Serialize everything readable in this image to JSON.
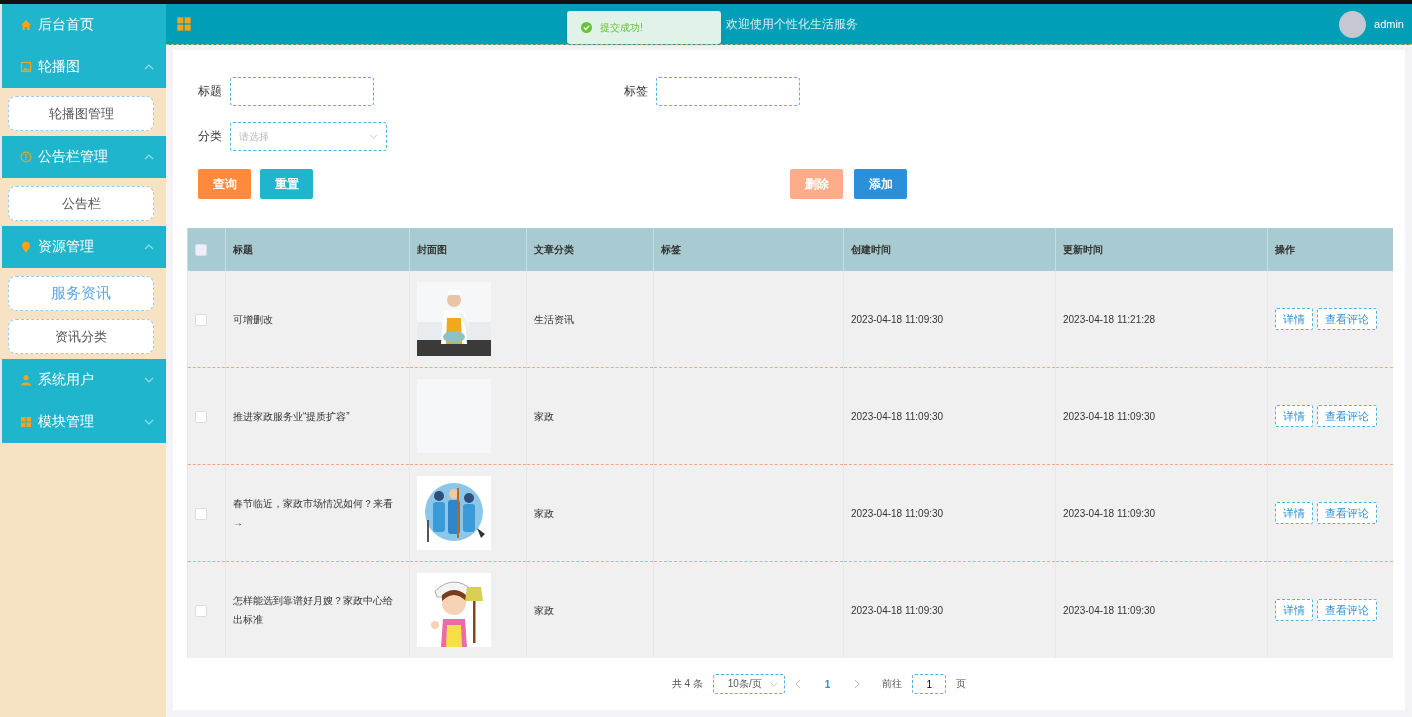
{
  "sidebar": {
    "items": [
      {
        "kind": "link",
        "label": "后台首页"
      },
      {
        "kind": "group",
        "label": "轮播图",
        "expanded": true,
        "children": [
          {
            "label": "轮播图管理",
            "selected": false
          }
        ]
      },
      {
        "kind": "group",
        "label": "公告栏管理",
        "expanded": true,
        "children": [
          {
            "label": "公告栏",
            "selected": false
          }
        ]
      },
      {
        "kind": "group",
        "label": "资源管理",
        "expanded": true,
        "children": [
          {
            "label": "服务资讯",
            "selected": true
          },
          {
            "label": "资讯分类",
            "selected": false
          }
        ]
      },
      {
        "kind": "group",
        "label": "系统用户",
        "expanded": false
      },
      {
        "kind": "group",
        "label": "模块管理",
        "expanded": false
      }
    ]
  },
  "header": {
    "title": "欢迎使用个性化生活服务",
    "user": "admin"
  },
  "toast": {
    "message": "提交成功!"
  },
  "filters": [
    {
      "kind": "input",
      "label": "标题"
    },
    {
      "kind": "input",
      "label": "标签"
    },
    {
      "kind": "select",
      "label": "分类",
      "placeholder": "请选择"
    }
  ],
  "actions_left": [
    {
      "label": "查询",
      "kind": "search",
      "disabled": false
    },
    {
      "label": "重置",
      "kind": "reset",
      "disabled": false
    }
  ],
  "actions_right": [
    {
      "label": "删除",
      "kind": "delete",
      "disabled": true
    },
    {
      "label": "添加",
      "kind": "add",
      "disabled": false
    }
  ],
  "table": {
    "select_all": {
      "checked": false
    },
    "columns": [
      "标题",
      "封面图",
      "文章分类",
      "标签",
      "创建时间",
      "更新时间",
      "操作"
    ],
    "rows": [
      {
        "checked": false,
        "title": "可增删改",
        "cover": {
          "kind": "picture"
        },
        "category": "生活资讯",
        "created": "2023-04-18 11:09:30",
        "updated": "2023-04-18 11:21:28",
        "actions": [
          "详情",
          "查看评论"
        ]
      },
      {
        "checked": false,
        "title": "推进家政服务业“提质扩容”",
        "cover": {
          "kind": "blank"
        },
        "category": "家政",
        "created": "2023-04-18 11:09:30",
        "updated": "2023-04-18 11:09:30",
        "actions": [
          "详情",
          "查看评论"
        ]
      },
      {
        "checked": false,
        "title": "春节临近，家政市场情况如何？来看→",
        "cover": {
          "kind": "picture"
        },
        "category": "家政",
        "created": "2023-04-18 11:09:30",
        "updated": "2023-04-18 11:09:30",
        "actions": [
          "详情",
          "查看评论"
        ]
      },
      {
        "checked": false,
        "title": "怎样能选到靠谱好月嫂？家政中心给出标准",
        "cover": {
          "kind": "picture"
        },
        "category": "家政",
        "created": "2023-04-18 11:09:30",
        "updated": "2023-04-18 11:09:30",
        "actions": [
          "详情",
          "查看评论"
        ]
      }
    ]
  },
  "pagination": {
    "total": "共 4 条",
    "page_size": "10条/页",
    "pages": [
      {
        "label": "1",
        "selected": true
      }
    ],
    "goto_label": "前往",
    "goto_value": "1",
    "goto_suffix": "页"
  }
}
